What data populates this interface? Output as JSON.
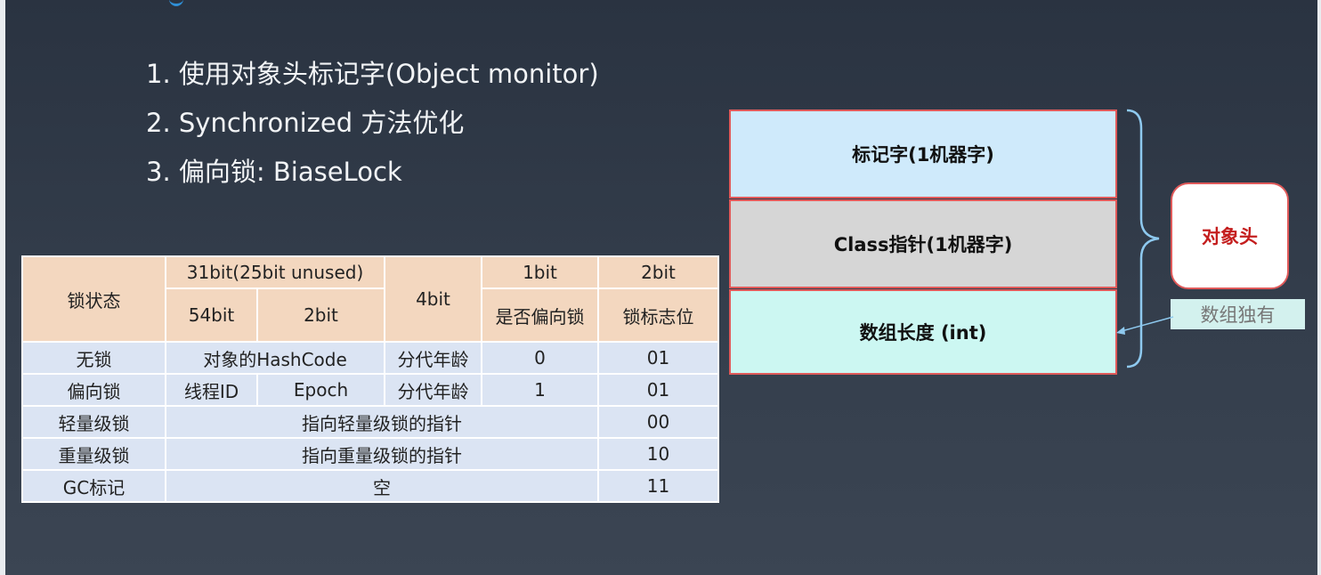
{
  "bullets": [
    "1. 使用对象头标记字(Object monitor)",
    "2. Synchronized 方法优化",
    "3. 偏向锁: BiaseLock"
  ],
  "table": {
    "header": {
      "lock_state": "锁状态",
      "bits31": "31bit(25bit unused)",
      "bits4": "4bit",
      "bit1": "1bit",
      "bits2": "2bit",
      "bits54": "54bit",
      "bits2b": "2bit",
      "biased_flag": "是否偏向锁",
      "lock_flag": "锁标志位"
    },
    "rows": {
      "no_lock": {
        "state": "无锁",
        "hash": "对象的HashCode",
        "age": "分代年龄",
        "biased": "0",
        "flag": "01"
      },
      "biased": {
        "state": "偏向锁",
        "thread": "线程ID",
        "epoch": "Epoch",
        "age": "分代年龄",
        "biased": "1",
        "flag": "01"
      },
      "light": {
        "state": "轻量级锁",
        "pointer": "指向轻量级锁的指针",
        "flag": "00"
      },
      "heavy": {
        "state": "重量级锁",
        "pointer": "指向重量级锁的指针",
        "flag": "10"
      },
      "gc": {
        "state": "GC标记",
        "content": "空",
        "flag": "11"
      }
    }
  },
  "diagram": {
    "mark_word": "标记字(1机器字)",
    "class_pointer": "Class指针(1机器字)",
    "array_length": "数组长度 (int)",
    "object_header": "对象头",
    "array_only": "数组独有"
  },
  "colors": {
    "header_bg": "#f3d7bf",
    "body_bg": "#dbe4f3",
    "mark_word_bg": "#cfeafb",
    "class_pointer_bg": "#d6d6d6",
    "array_length_bg": "#ccf7f2",
    "border_red": "#e05a5a",
    "label_red": "#c41e1e",
    "brace_blue": "#8ec9ef"
  }
}
